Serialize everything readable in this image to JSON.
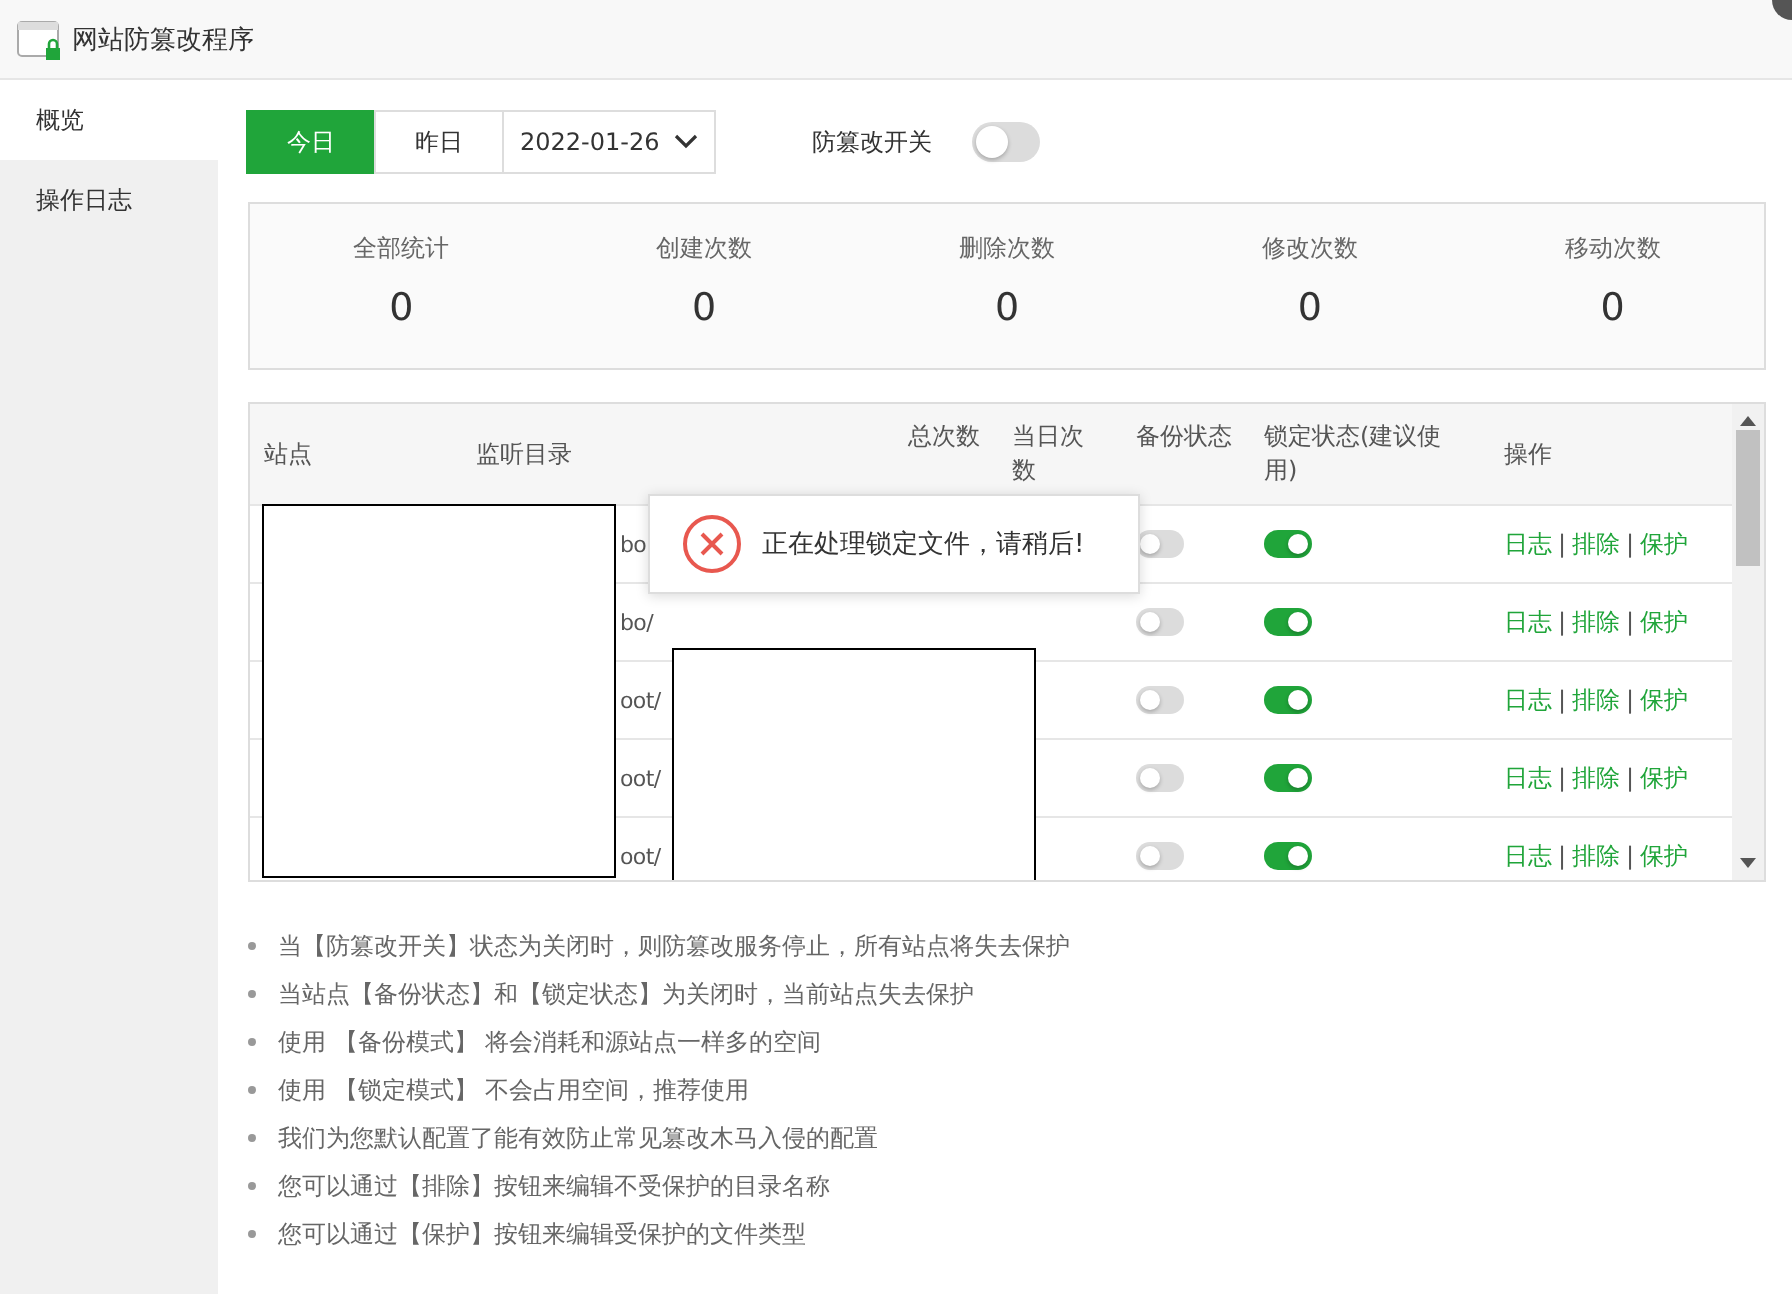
{
  "window": {
    "title": "网站防篡改程序"
  },
  "sidebar": {
    "items": [
      {
        "label": "概览",
        "selected": true
      },
      {
        "label": "操作日志",
        "selected": false
      }
    ]
  },
  "day_tabs": [
    {
      "label": "今日",
      "selected": true
    },
    {
      "label": "昨日",
      "selected": false
    }
  ],
  "date_select": {
    "value": "2022-01-26"
  },
  "master_switch": {
    "label": "防篡改开关",
    "on": false
  },
  "stats": [
    {
      "label": "全部统计",
      "value": "0"
    },
    {
      "label": "创建次数",
      "value": "0"
    },
    {
      "label": "删除次数",
      "value": "0"
    },
    {
      "label": "修改次数",
      "value": "0"
    },
    {
      "label": "移动次数",
      "value": "0"
    }
  ],
  "table": {
    "columns": [
      "站点",
      "监听目录",
      "总次数",
      "当日次数",
      "备份状态",
      "锁定状态(建议使用)",
      "操作"
    ],
    "rows": [
      {
        "directory": "bo",
        "backup": false,
        "lock": true,
        "actions": [
          {
            "kind": "link",
            "text": "日志"
          },
          {
            "kind": "separator",
            "text": "|"
          },
          {
            "kind": "link",
            "text": "排除"
          },
          {
            "kind": "separator",
            "text": "|"
          },
          {
            "kind": "link",
            "text": "保护"
          }
        ]
      },
      {
        "directory": "bo/",
        "backup": false,
        "lock": true,
        "actions": [
          {
            "kind": "link",
            "text": "日志"
          },
          {
            "kind": "separator",
            "text": "|"
          },
          {
            "kind": "link",
            "text": "排除"
          },
          {
            "kind": "separator",
            "text": "|"
          },
          {
            "kind": "link",
            "text": "保护"
          }
        ]
      },
      {
        "directory": "oot/",
        "backup": false,
        "lock": true,
        "actions": [
          {
            "kind": "link",
            "text": "日志"
          },
          {
            "kind": "separator",
            "text": "|"
          },
          {
            "kind": "link",
            "text": "排除"
          },
          {
            "kind": "separator",
            "text": "|"
          },
          {
            "kind": "link",
            "text": "保护"
          }
        ]
      },
      {
        "directory": "oot/",
        "backup": false,
        "lock": true,
        "actions": [
          {
            "kind": "link",
            "text": "日志"
          },
          {
            "kind": "separator",
            "text": "|"
          },
          {
            "kind": "link",
            "text": "排除"
          },
          {
            "kind": "separator",
            "text": "|"
          },
          {
            "kind": "link",
            "text": "保护"
          }
        ]
      },
      {
        "directory": "oot/",
        "backup": false,
        "lock": true,
        "actions": [
          {
            "kind": "link",
            "text": "日志"
          },
          {
            "kind": "separator",
            "text": "|"
          },
          {
            "kind": "link",
            "text": "排除"
          },
          {
            "kind": "separator",
            "text": "|"
          },
          {
            "kind": "link",
            "text": "保护"
          }
        ]
      }
    ]
  },
  "toast": {
    "kind": "error",
    "message": "正在处理锁定文件，请稍后!"
  },
  "notes": [
    "当【防篡改开关】状态为关闭时，则防篡改服务停止，所有站点将失去保护",
    "当站点【备份状态】和【锁定状态】为关闭时，当前站点失去保护",
    "使用 【备份模式】 将会消耗和源站点一样多的空间",
    "使用 【锁定模式】 不会占用空间，推荐使用",
    "我们为您默认配置了能有效防止常见篡改木马入侵的配置",
    "您可以通过【排除】按钮来编辑不受保护的目录名称",
    "您可以通过【保护】按钮来编辑受保护的文件类型"
  ]
}
